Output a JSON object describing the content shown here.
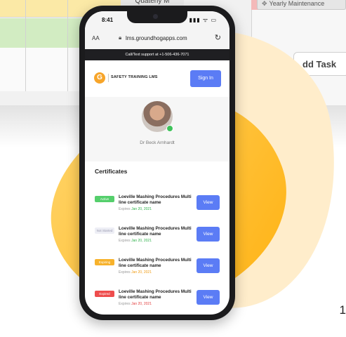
{
  "background": {
    "quarter_header": "Quaterly M",
    "yearly_button": "Yearly Maintenance",
    "add_task_button": "dd Task",
    "page_number": "1"
  },
  "phone": {
    "status_time": "8:41",
    "status_icons": "▮▮▮ ᯤ ▭",
    "browser": {
      "aa_label": "AA",
      "url": "lms.groundhogapps.com",
      "reload_icon": "reload-icon"
    },
    "banner": "Call/Text support at +1-506-436-7071",
    "logo_letter": "G",
    "brand": "SAFETY TRAINING LMS",
    "sign_in": "Sign In",
    "user_name": "Dr Beck Arnhardt",
    "certificates_heading": "Certificates",
    "certificates": [
      {
        "status": "Active",
        "name": "Loeville Mashing Procedures Multi line certificate name",
        "expires_prefix": "Expires",
        "expires_date": "Jan 20, 2021"
      },
      {
        "status": "Not Started",
        "name": "Loeville Mashing Procedures Multi line certificate name",
        "expires_prefix": "Expires",
        "expires_date": "Jan 20, 2021"
      },
      {
        "status": "Expiring",
        "name": "Loeville Mashing Procedures Multi line certificate name",
        "expires_prefix": "Expires",
        "expires_date": "Jan 20, 2021"
      },
      {
        "status": "Expired",
        "name": "Loeville Mashing Procedures Multi line certificate name",
        "expires_prefix": "Expires",
        "expires_date": "Jan 20, 2021"
      }
    ],
    "view_label": "View"
  },
  "colors": {
    "accent_blue": "#5b7cf5",
    "active_green": "#55cf6c",
    "expiring_orange": "#f7b22c",
    "expired_red": "#ee4d4d",
    "blob_orange": "#ffb212"
  }
}
